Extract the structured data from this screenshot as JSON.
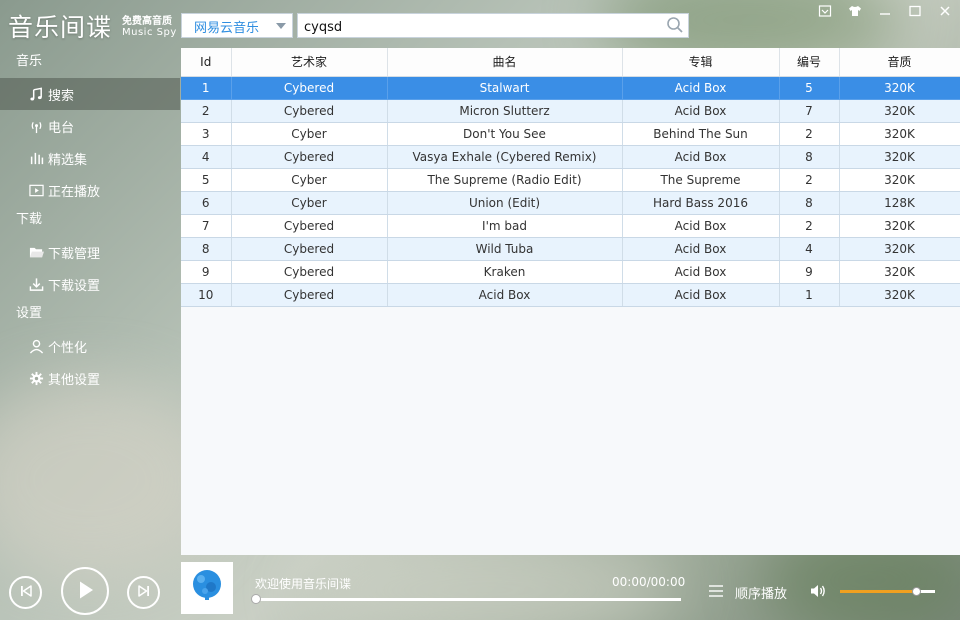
{
  "app": {
    "title": "音乐间谍",
    "tagline": "免费高音质",
    "tagline_en": "Music Spy"
  },
  "header": {
    "source": "网易云音乐",
    "search_value": "cyqsd"
  },
  "sidebar": {
    "sections": [
      {
        "label": "音乐",
        "items": [
          {
            "label": "搜索",
            "icon": "music-note-icon",
            "active": true
          },
          {
            "label": "电台",
            "icon": "radio-icon",
            "active": false
          },
          {
            "label": "精选集",
            "icon": "bars-icon",
            "active": false
          },
          {
            "label": "正在播放",
            "icon": "play-screen-icon",
            "active": false
          }
        ]
      },
      {
        "label": "下载",
        "items": [
          {
            "label": "下载管理",
            "icon": "folder-icon",
            "active": false
          },
          {
            "label": "下载设置",
            "icon": "download-icon",
            "active": false
          }
        ]
      },
      {
        "label": "设置",
        "items": [
          {
            "label": "个性化",
            "icon": "user-icon",
            "active": false
          },
          {
            "label": "其他设置",
            "icon": "gear-icon",
            "active": false
          }
        ]
      }
    ]
  },
  "table": {
    "columns": [
      "Id",
      "艺术家",
      "曲名",
      "专辑",
      "编号",
      "音质"
    ],
    "selected_index": 0,
    "rows": [
      [
        "1",
        "Cybered",
        "Stalwart",
        "Acid Box",
        "5",
        "320K"
      ],
      [
        "2",
        "Cybered",
        "Micron Slutterz",
        "Acid Box",
        "7",
        "320K"
      ],
      [
        "3",
        "Cyber",
        "Don't You See",
        "Behind The Sun",
        "2",
        "320K"
      ],
      [
        "4",
        "Cybered",
        "Vasya Exhale (Cybered Remix)",
        "Acid Box",
        "8",
        "320K"
      ],
      [
        "5",
        "Cyber",
        "The Supreme (Radio Edit)",
        "The Supreme",
        "2",
        "320K"
      ],
      [
        "6",
        "Cyber",
        "Union (Edit)",
        "Hard Bass 2016",
        "8",
        "128K"
      ],
      [
        "7",
        "Cybered",
        "I'm bad",
        "Acid Box",
        "2",
        "320K"
      ],
      [
        "8",
        "Cybered",
        "Wild Tuba",
        "Acid Box",
        "4",
        "320K"
      ],
      [
        "9",
        "Cybered",
        "Kraken",
        "Acid Box",
        "9",
        "320K"
      ],
      [
        "10",
        "Cybered",
        "Acid Box",
        "Acid Box",
        "1",
        "320K"
      ]
    ]
  },
  "player": {
    "welcome": "欢迎使用音乐间谍",
    "time": "00:00/00:00",
    "progress": 0,
    "mode": "顺序播放",
    "volume": 0.8
  },
  "colors": {
    "accent": "#3a8ee6",
    "volume": "#f0a020"
  }
}
